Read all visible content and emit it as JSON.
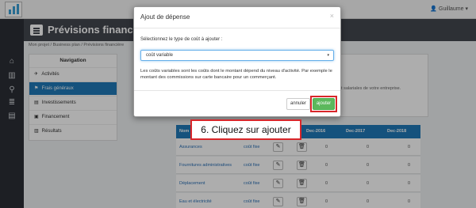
{
  "topbar": {
    "user_label": "Guillaume",
    "user_caret": "▾"
  },
  "rail": {
    "icons": [
      "⌂",
      "▥",
      "⚲",
      "≣",
      "▤"
    ]
  },
  "header": {
    "title": "Prévisions financières"
  },
  "breadcrumb": "Mon projet  /  Business plan  /  Prévisions financière",
  "navigation": {
    "title": "Navigation",
    "items": [
      {
        "icon": "✈",
        "label": "Activités"
      },
      {
        "icon": "⚑",
        "label": "Frais généraux"
      },
      {
        "icon": "▤",
        "label": "Investissements"
      },
      {
        "icon": "▣",
        "label": "Financement"
      },
      {
        "icon": "▥",
        "label": "Résultats"
      }
    ]
  },
  "background_text": "et salariales de votre entreprise.",
  "table": {
    "headers": [
      "Nom",
      "Dec-2016",
      "Dec-2017",
      "Dec-2018"
    ],
    "fee_label": "coût fixe",
    "edit_icon": "✎",
    "delete_icon": "🗑",
    "rows": [
      {
        "name": "Assurances",
        "values": [
          "0",
          "0",
          "0"
        ]
      },
      {
        "name": "Fournitures administratives",
        "values": [
          "0",
          "0",
          "0"
        ]
      },
      {
        "name": "Déplacement",
        "values": [
          "0",
          "0",
          "0"
        ]
      },
      {
        "name": "Eau et électricité",
        "values": [
          "0",
          "0",
          "0"
        ]
      }
    ]
  },
  "modal": {
    "title": "Ajout de dépense",
    "close": "×",
    "select_label": "Sélectionnez le type de coût à ajouter :",
    "select_value": "coût variable",
    "select_caret": "▾",
    "description": "Les coûts variables sont les coûts dont le montant dépend du niveau d'activité. Par exemple le montant des commissions sur carte bancaire pour un commerçant.",
    "cancel_label": "annuler",
    "add_label": "ajouter"
  },
  "callout": "6. Cliquez sur ajouter",
  "colors": {
    "accent": "#1f7ab8",
    "header": "#43474f",
    "success": "#5cb85c",
    "highlight": "#d9262a"
  }
}
